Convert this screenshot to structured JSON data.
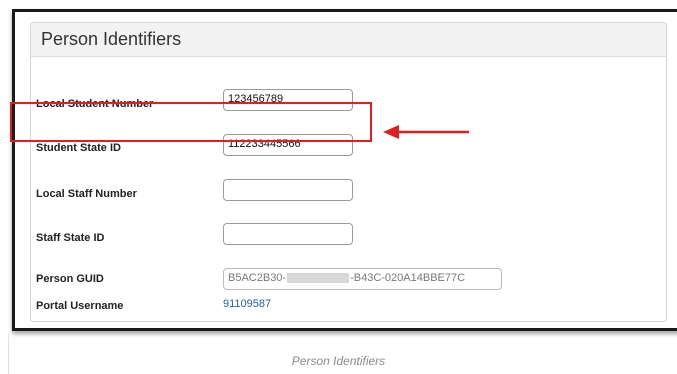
{
  "panel": {
    "title": "Person Identifiers"
  },
  "fields": [
    {
      "label": "Local Student Number",
      "value": "123456789"
    },
    {
      "label": "Student State ID",
      "value": "112233445566"
    },
    {
      "label": "Local Staff Number",
      "value": ""
    },
    {
      "label": "Staff State ID",
      "value": ""
    }
  ],
  "guid": {
    "label": "Person GUID",
    "value_prefix": "B5AC2B30-",
    "value_suffix": "-B43C-020A14BBE77C"
  },
  "portal": {
    "label": "Portal Username",
    "value": "91109587"
  },
  "annotation": {
    "highlight_color": "#e02020"
  },
  "caption": "Person Identifiers"
}
